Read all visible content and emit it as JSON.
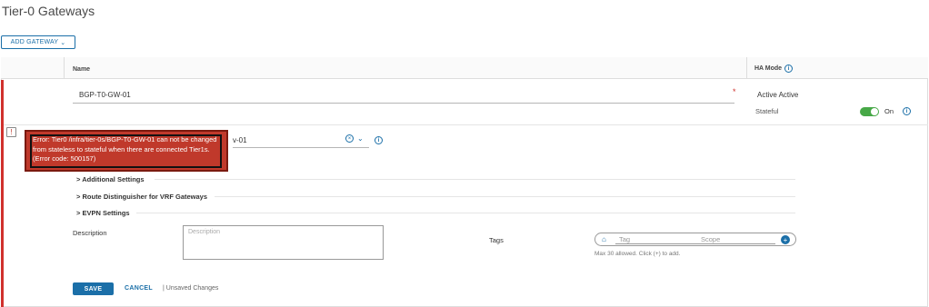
{
  "page": {
    "title": "Tier-0 Gateways"
  },
  "toolbar": {
    "add_gateway_label": "ADD GATEWAY",
    "add_gateway_caret": "⌄"
  },
  "table": {
    "headers": {
      "name": "Name",
      "ha_mode": "HA Mode"
    }
  },
  "gateway": {
    "name_value": "BGP-T0-GW-01",
    "required_marker": "*",
    "ha_mode_value": "Active Active",
    "stateful_label": "Stateful",
    "stateful_state": "On",
    "stateful_on": true,
    "select_value_partial": "v-01"
  },
  "error": {
    "message": "Error: Tier0 /infra/tier-0s/BGP-T0-GW-01 can not be changed from stateless to stateful when there are connected Tier1s. (Error code: 500157)"
  },
  "sections": {
    "additional": "Additional Settings",
    "route_distinguisher": "Route Distinguisher for VRF Gateways",
    "evpn": "EVPN Settings",
    "chevron": ">"
  },
  "form": {
    "description_label": "Description",
    "description_placeholder": "Description",
    "tags_label": "Tags",
    "tag_placeholder": "Tag",
    "scope_placeholder": "Scope",
    "tags_hint": "Max 30 allowed. Click (+) to add."
  },
  "actions": {
    "save_label": "SAVE",
    "cancel_label": "CANCEL",
    "separator": "|",
    "unsaved_label": "Unsaved Changes"
  },
  "icons": {
    "info": "info-circle-icon",
    "clear": "clear-circle-icon",
    "caret": "chevron-down-icon",
    "alert": "alert-icon",
    "tag": "tag-icon",
    "plus": "plus-circle-icon"
  },
  "colors": {
    "accent": "#1b6fa8",
    "error": "#c0392b",
    "toggle_on": "#47a847"
  }
}
